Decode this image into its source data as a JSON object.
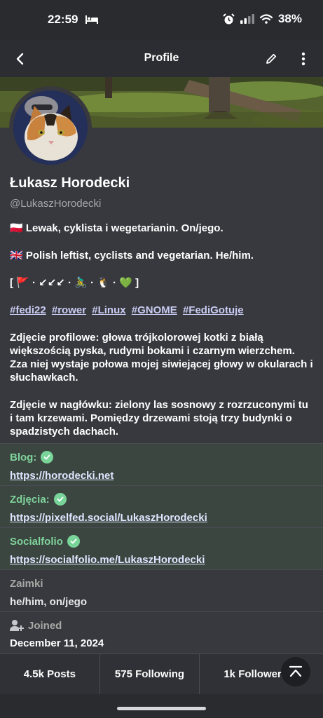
{
  "status_bar": {
    "time": "22:59",
    "battery": "38%",
    "icons": [
      "bed-icon",
      "alarm-icon",
      "signal-icon",
      "wifi-icon"
    ]
  },
  "app_bar": {
    "title": "Profile",
    "icons": [
      "back-arrow-icon",
      "pencil-icon",
      "more-vertical-icon"
    ]
  },
  "profile": {
    "display_name": "Łukasz Horodecki",
    "handle": "@LukaszHorodecki",
    "bio": {
      "line_pl": "🇵🇱 Lewak, cyklista i wegetarianin. On/jego.",
      "line_en": "🇬🇧 Polish leftist, cyclists and vegetarian. He/him.",
      "emoji_line": "[ 🚩 · ↙↙↙ · 🚴‍♂️ · 🐧 · 💚 ]",
      "tags": [
        "#fedi22",
        "#rower",
        "#Linux",
        "#GNOME",
        "#FediGotuje"
      ],
      "avatar_desc": "Zdjęcie profilowe: głowa trójkolorowej kotki z białą większością pyska, rudymi bokami i czarnym wierzchem. Zza niej wystaje połowa mojej siwiejącej głowy w okularach i słuchawkach.",
      "header_desc": "Zdjęcie w nagłówku: zielony las sosnowy z rozrzuconymi tu i tam krzewami. Pomiędzy drzewami stoją trzy budynki o spadzistych dachach."
    }
  },
  "fields": [
    {
      "label": "Blog:",
      "value": "https://horodecki.net",
      "verified": true
    },
    {
      "label": "Zdjęcia:",
      "value": "https://pixelfed.social/LukaszHorodecki",
      "verified": true
    },
    {
      "label": "Socialfolio",
      "value": "https://socialfolio.me/LukaszHorodecki",
      "verified": true
    },
    {
      "label": "Zaimki",
      "value": "he/him, on/jego",
      "verified": false
    }
  ],
  "joined": {
    "label": "Joined",
    "date": "December 11, 2024"
  },
  "stats": {
    "posts": "4.5k Posts",
    "following": "575 Following",
    "followers": "1k Followers"
  },
  "colors": {
    "background": "#38393f",
    "verified_green": "#79d49a",
    "link": "#c9ccf2"
  }
}
